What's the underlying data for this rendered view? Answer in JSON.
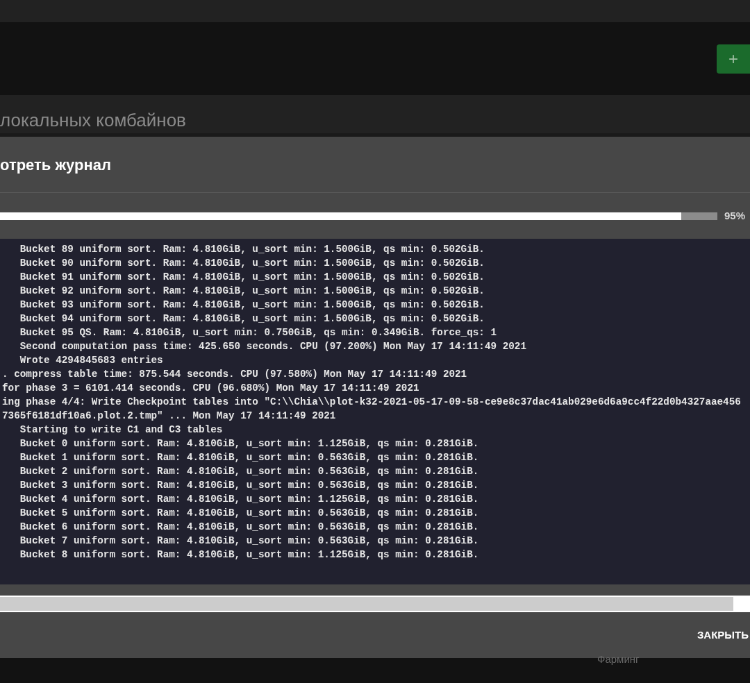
{
  "add_button": {
    "label": "+"
  },
  "section_title": "локальных комбайнов",
  "dialog": {
    "title": "отреть журнал",
    "progress": {
      "level": 0.95,
      "reading": "95%"
    },
    "log_lines": [
      "   Bucket 89 uniform sort. Ram: 4.810GiB, u_sort min: 1.500GiB, qs min: 0.502GiB.",
      "   Bucket 90 uniform sort. Ram: 4.810GiB, u_sort min: 1.500GiB, qs min: 0.502GiB.",
      "   Bucket 91 uniform sort. Ram: 4.810GiB, u_sort min: 1.500GiB, qs min: 0.502GiB.",
      "   Bucket 92 uniform sort. Ram: 4.810GiB, u_sort min: 1.500GiB, qs min: 0.502GiB.",
      "   Bucket 93 uniform sort. Ram: 4.810GiB, u_sort min: 1.500GiB, qs min: 0.502GiB.",
      "   Bucket 94 uniform sort. Ram: 4.810GiB, u_sort min: 1.500GiB, qs min: 0.502GiB.",
      "   Bucket 95 QS. Ram: 4.810GiB, u_sort min: 0.750GiB, qs min: 0.349GiB. force_qs: 1",
      "   Second computation pass time: 425.650 seconds. CPU (97.200%) Mon May 17 14:11:49 2021",
      "   Wrote 4294845683 entries",
      ". compress table time: 875.544 seconds. CPU (97.580%) Mon May 17 14:11:49 2021",
      "for phase 3 = 6101.414 seconds. CPU (96.680%) Mon May 17 14:11:49 2021",
      "ing phase 4/4: Write Checkpoint tables into \"C:\\\\Chia\\\\plot-k32-2021-05-17-09-58-ce9e8c37dac41ab029e6d6a9cc4f22d0b4327aae456",
      "7365f6181df10a6.plot.2.tmp\" ... Mon May 17 14:11:49 2021",
      "   Starting to write C1 and C3 tables",
      "   Bucket 0 uniform sort. Ram: 4.810GiB, u_sort min: 1.125GiB, qs min: 0.281GiB.",
      "   Bucket 1 uniform sort. Ram: 4.810GiB, u_sort min: 0.563GiB, qs min: 0.281GiB.",
      "   Bucket 2 uniform sort. Ram: 4.810GiB, u_sort min: 0.563GiB, qs min: 0.281GiB.",
      "   Bucket 3 uniform sort. Ram: 4.810GiB, u_sort min: 0.563GiB, qs min: 0.281GiB.",
      "   Bucket 4 uniform sort. Ram: 4.810GiB, u_sort min: 1.125GiB, qs min: 0.281GiB.",
      "   Bucket 5 uniform sort. Ram: 4.810GiB, u_sort min: 0.563GiB, qs min: 0.281GiB.",
      "   Bucket 6 uniform sort. Ram: 4.810GiB, u_sort min: 0.563GiB, qs min: 0.281GiB.",
      "   Bucket 7 uniform sort. Ram: 4.810GiB, u_sort min: 0.563GiB, qs min: 0.281GiB.",
      "   Bucket 8 uniform sort. Ram: 4.810GiB, u_sort min: 1.125GiB, qs min: 0.281GiB."
    ],
    "close_button": "ЗАКРЫТЬ"
  },
  "nav_label": "Фарминг"
}
